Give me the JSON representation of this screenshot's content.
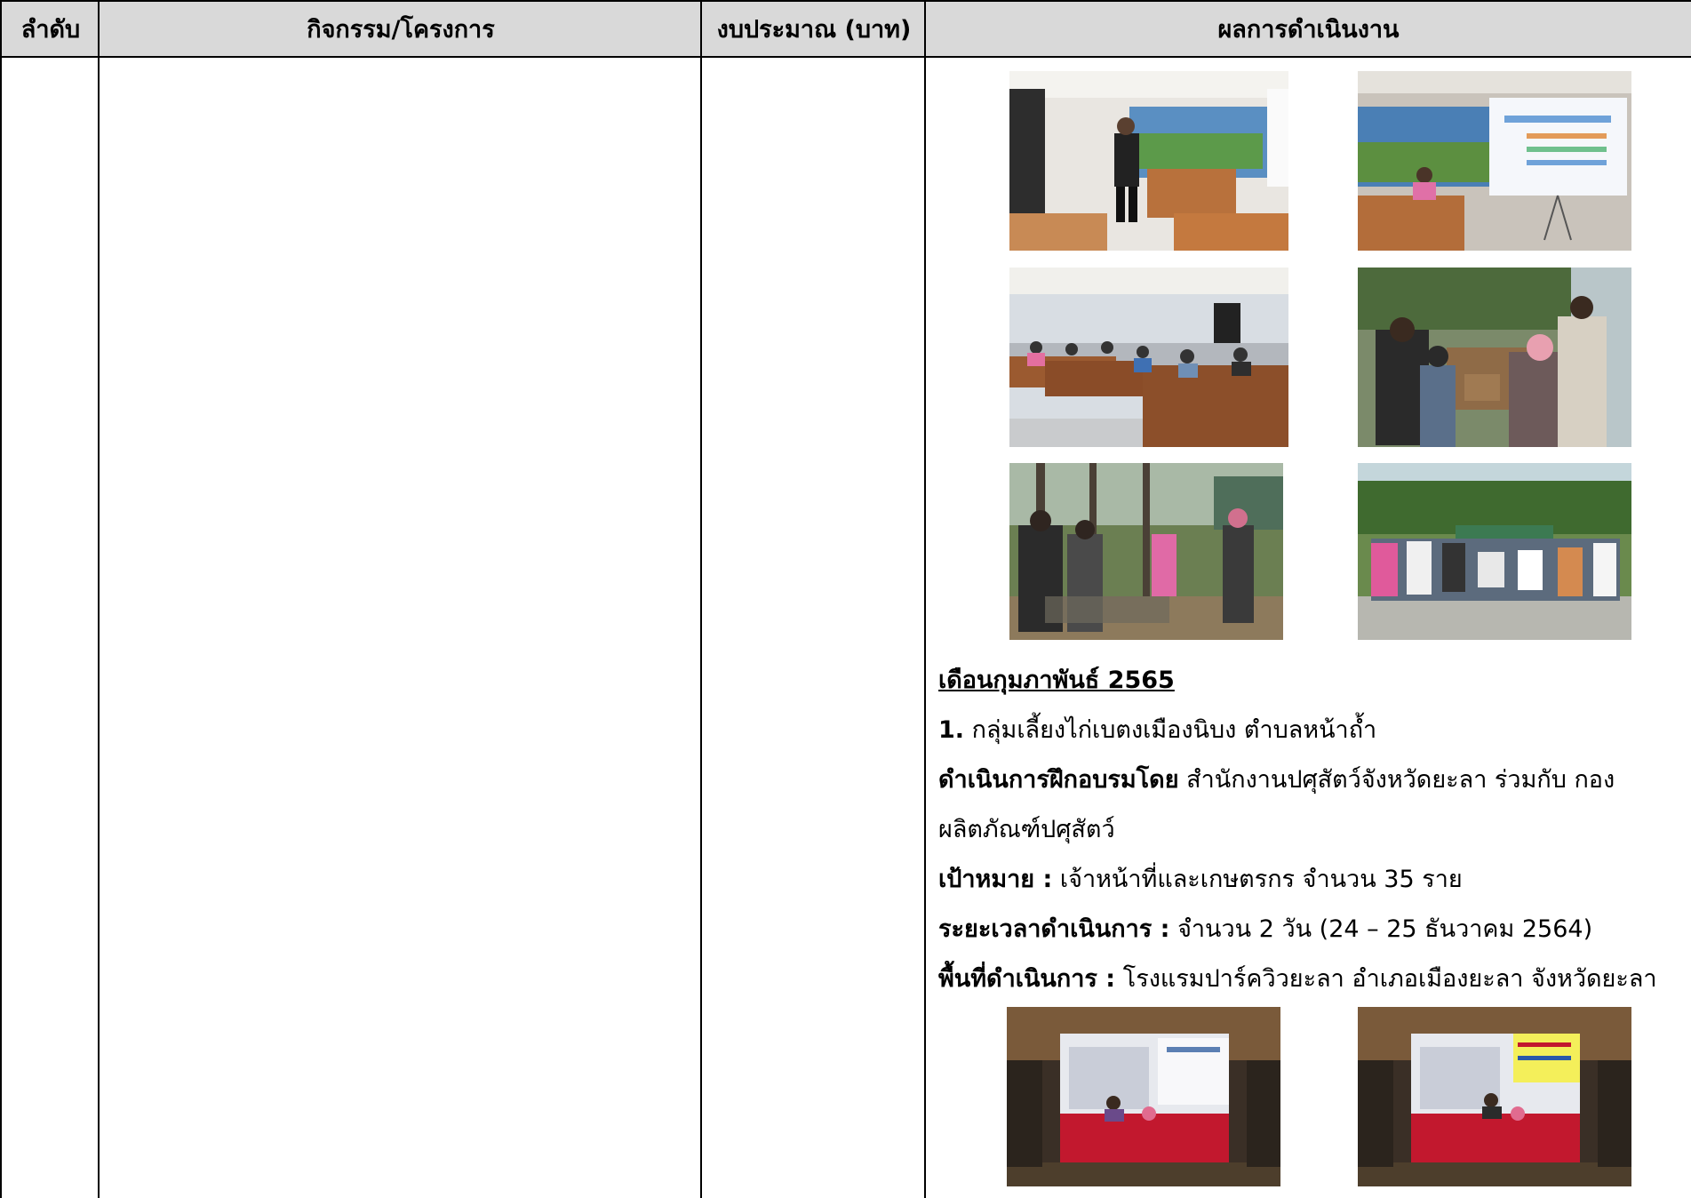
{
  "table": {
    "headers": {
      "order": "ลำดับ",
      "activity": "กิจกรรม/โครงการ",
      "budget": "งบประมาณ (บาท)",
      "result": "ผลการดำเนินงาน"
    }
  },
  "result": {
    "month_heading": "เดือนกุมภาพันธ์ 2565",
    "item_number": "1.",
    "item_text": "กลุ่มเลี้ยงไก่เบตงเมืองนิบง ตำบลหน้าถ้ำ",
    "trainer_label": "ดำเนินการฝึกอบรมโดย",
    "trainer_text_line1": "สำนักงานปศุสัตว์จังหวัดยะลา ร่วมกับ กอง",
    "trainer_text_line2": "ผลิตภัณฑ์ปศุสัตว์",
    "target_label": "เป้าหมาย :",
    "target_text": "เจ้าหน้าที่และเกษตรกร จำนวน 35 ราย",
    "duration_label": "ระยะเวลาดำเนินการ :",
    "duration_text": "จำนวน 2 วัน (24 – 25 ธันวาคม 2564)",
    "area_label": "พื้นที่ดำเนินการ :",
    "area_text": "โรงแรมปาร์ควิวยะลา อำเภอเมืองยะลา จังหวัดยะลา"
  },
  "photos": [
    {
      "name": "photo-speaker-standing"
    },
    {
      "name": "photo-presentation-screen"
    },
    {
      "name": "photo-training-participants"
    },
    {
      "name": "photo-group-practical"
    },
    {
      "name": "photo-field-visit-coop"
    },
    {
      "name": "photo-group-outdoor"
    },
    {
      "name": "photo-hotel-meeting-1"
    },
    {
      "name": "photo-hotel-meeting-2"
    }
  ],
  "colors": {
    "header_bg": "#d9d9d9",
    "border": "#000000"
  }
}
